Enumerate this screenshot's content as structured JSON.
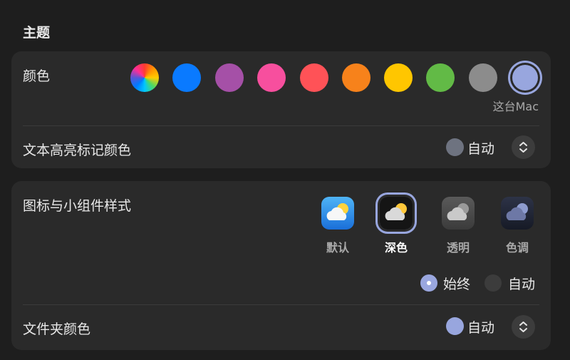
{
  "section_title": "主题",
  "color_row": {
    "label": "颜色",
    "swatches": [
      {
        "name": "multicolor",
        "color": "conic"
      },
      {
        "name": "blue",
        "color": "#0a7aff"
      },
      {
        "name": "purple",
        "color": "#a550a7"
      },
      {
        "name": "pink",
        "color": "#f74f9e"
      },
      {
        "name": "red",
        "color": "#ff5257"
      },
      {
        "name": "orange",
        "color": "#f7821b"
      },
      {
        "name": "yellow",
        "color": "#ffc600"
      },
      {
        "name": "green",
        "color": "#62ba46"
      },
      {
        "name": "graphite",
        "color": "#8c8c8c"
      },
      {
        "name": "this-mac",
        "color": "#98a6de",
        "selected": true
      }
    ],
    "selected_caption": "这台Mac"
  },
  "highlight_row": {
    "label": "文本高亮标记颜色",
    "value": "自动",
    "dot_color": "#6e7380"
  },
  "icon_row": {
    "label": "图标与小组件样式",
    "options": [
      {
        "label": "默认",
        "style": "default"
      },
      {
        "label": "深色",
        "style": "dark",
        "selected": true
      },
      {
        "label": "透明",
        "style": "clear"
      },
      {
        "label": "色调",
        "style": "tinted"
      }
    ],
    "radio": [
      {
        "label": "始终",
        "checked": true
      },
      {
        "label": "自动",
        "checked": false
      }
    ]
  },
  "folder_row": {
    "label": "文件夹颜色",
    "value": "自动",
    "dot_color": "#98a6de"
  },
  "accent_color": "#98a6de"
}
